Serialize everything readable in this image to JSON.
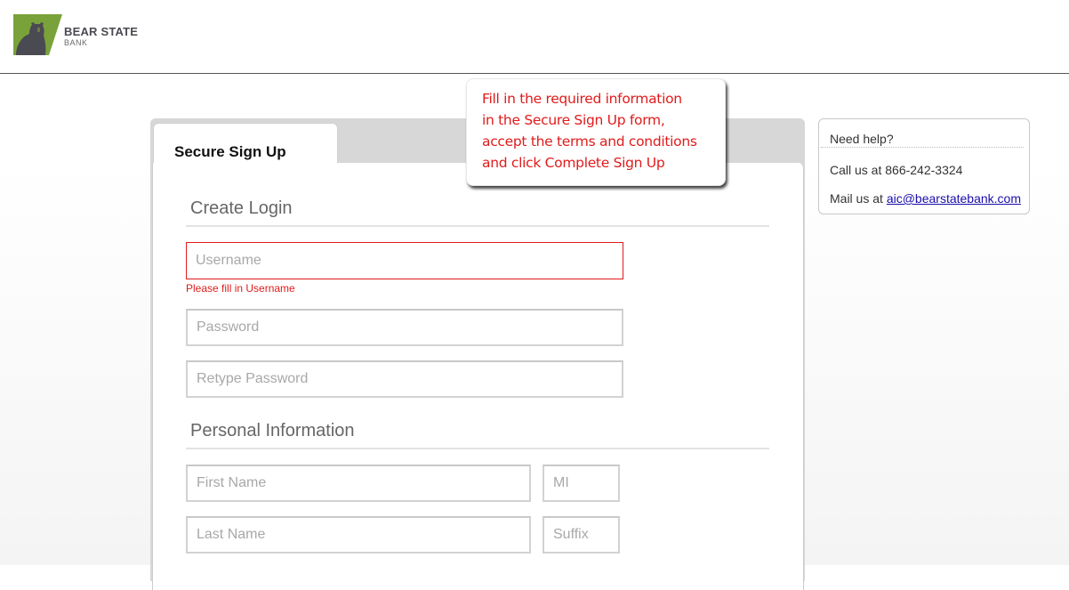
{
  "brand": {
    "name": "BEAR STATE",
    "subname": "BANK",
    "colors": {
      "green": "#7aa23a",
      "charcoal": "#4a4a52"
    }
  },
  "tab": {
    "label": "Secure Sign Up"
  },
  "tooltip": {
    "lines": [
      "Fill in the required information",
      "in the Secure Sign Up form,",
      "accept the terms and conditions",
      "and click Complete Sign Up"
    ],
    "color": "#e01b1b"
  },
  "sections": {
    "create_login": "Create Login",
    "personal_info": "Personal Information"
  },
  "fields": {
    "username": {
      "placeholder": "Username",
      "value": "",
      "error": "Please fill in Username"
    },
    "password": {
      "placeholder": "Password",
      "value": ""
    },
    "retype_password": {
      "placeholder": "Retype Password",
      "value": ""
    },
    "first_name": {
      "placeholder": "First Name",
      "value": ""
    },
    "mi": {
      "placeholder": "MI",
      "value": ""
    },
    "last_name": {
      "placeholder": "Last Name",
      "value": ""
    },
    "suffix": {
      "placeholder": "Suffix",
      "value": ""
    }
  },
  "help": {
    "title": "Need help?",
    "call_prefix": "Call us at",
    "phone": "866-242-3324",
    "mail_prefix": "Mail us at",
    "email": "aic@bearstatebank.com"
  }
}
